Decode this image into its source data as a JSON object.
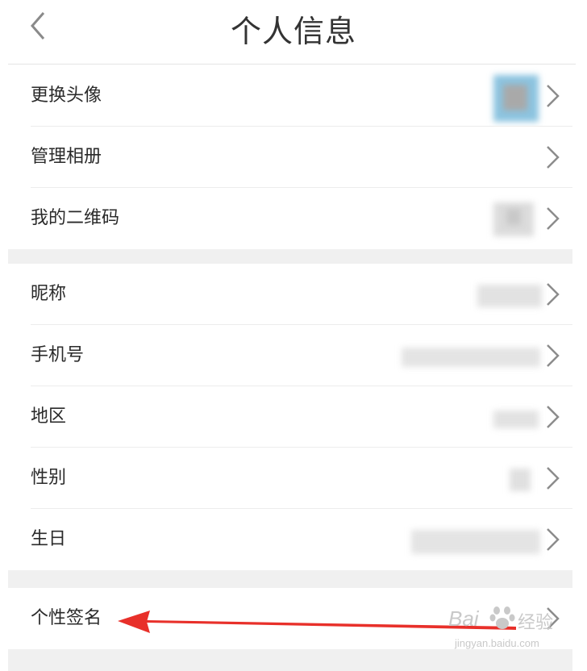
{
  "header": {
    "title": "个人信息"
  },
  "group1": [
    {
      "label": "更换头像"
    },
    {
      "label": "管理相册"
    },
    {
      "label": "我的二维码"
    }
  ],
  "group2": [
    {
      "label": "昵称"
    },
    {
      "label": "手机号"
    },
    {
      "label": "地区"
    },
    {
      "label": "性别"
    },
    {
      "label": "生日"
    }
  ],
  "group3": [
    {
      "label": "个性签名"
    }
  ],
  "watermark": {
    "brand": "Bai",
    "brand2": "经验",
    "url": "jingyan.baidu.com"
  },
  "colors": {
    "annotation_arrow": "#e8302a",
    "text": "#2a2a2a",
    "chevron": "#8c8c8c",
    "section_gap": "#f0f0f0"
  },
  "icons": {
    "back": "chevron-left-icon",
    "row_arrow": "chevron-right-icon"
  }
}
